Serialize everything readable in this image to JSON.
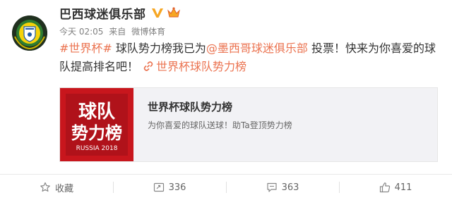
{
  "user": {
    "name": "巴西球迷俱乐部",
    "time": "今天 02:05",
    "source_prefix": "来自",
    "source": "微博体育"
  },
  "post": {
    "hashtag": "#世界杯#",
    "text_1": " 球队势力榜我已为",
    "mention": "@墨西哥球迷俱乐部",
    "text_2": " 投票！快来为你喜爱的球队提高排名吧！",
    "link_text": "世界杯球队势力榜"
  },
  "card": {
    "title": "世界杯球队势力榜",
    "description": "为你喜爱的球队送球！助Ta登顶势力榜",
    "thumb_line1": "球队",
    "thumb_line2": "势力榜",
    "thumb_caption": "RUSSIA 2018"
  },
  "actions": {
    "favorite_label": "收藏",
    "repost_count": "336",
    "comment_count": "363",
    "like_count": "411"
  },
  "colors": {
    "link": "#eb7350",
    "thumb_red": "#c8161d",
    "verify_orange": "#f6a623"
  },
  "icons": [
    "avatar-logo",
    "verified-icon",
    "crown-icon",
    "link-icon",
    "star-icon",
    "repost-icon",
    "comment-icon",
    "like-icon"
  ]
}
